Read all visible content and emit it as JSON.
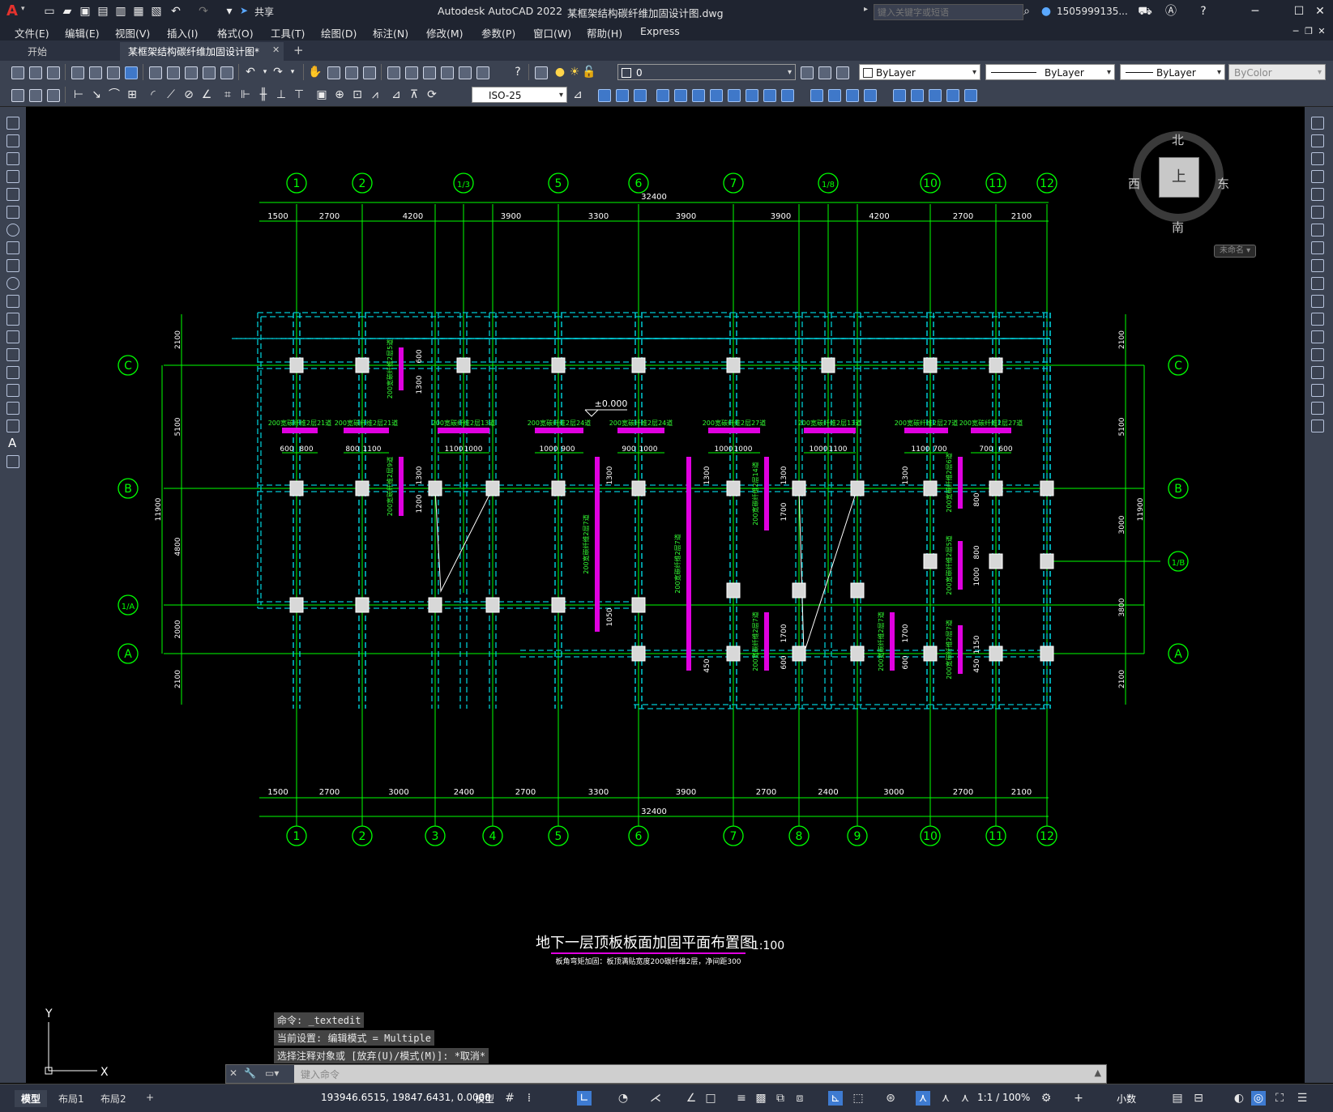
{
  "app": {
    "title": "Autodesk AutoCAD 2022",
    "filename": "某框架结构碳纤维加固设计图.dwg",
    "share_label": "共享",
    "search_placeholder": "键入关键字或短语",
    "user": "1505999135...",
    "logo_letter": "A"
  },
  "menu": [
    "文件(E)",
    "编辑(E)",
    "视图(V)",
    "插入(I)",
    "格式(O)",
    "工具(T)",
    "绘图(D)",
    "标注(N)",
    "修改(M)",
    "参数(P)",
    "窗口(W)",
    "帮助(H)",
    "Express"
  ],
  "tabs": {
    "start": "开始",
    "active": "某框架结构碳纤维加固设计图*",
    "add": "+"
  },
  "toolbar": {
    "layer_value": "0",
    "color": "ByLayer",
    "linetype": "ByLayer",
    "lineweight": "ByLayer",
    "plotstyle": "ByColor",
    "dimstyle": "ISO-25"
  },
  "viewcube": {
    "north": "北",
    "south": "南",
    "east": "东",
    "west": "西",
    "top": "上",
    "ucs": "未命名"
  },
  "drawing": {
    "title": "地下一层顶板板面加固平面布置图",
    "scale": "1:100",
    "note": "板角弯矩加固：板顶满贴宽度200碳纤维2层，净间距300",
    "elevation": "±0.000",
    "top_axes": [
      "1",
      "2",
      "1/3",
      "5",
      "6",
      "7",
      "1/8",
      "10",
      "11",
      "12"
    ],
    "bottom_axes": [
      "1",
      "2",
      "3",
      "4",
      "5",
      "6",
      "7",
      "8",
      "9",
      "10",
      "11",
      "12"
    ],
    "left_axes": [
      "C",
      "B",
      "1/A",
      "A"
    ],
    "right_axes": [
      "C",
      "B",
      "1/B",
      "A"
    ],
    "top_total": "32400",
    "top_dims": [
      "1500",
      "2700",
      "4200",
      "3900",
      "3300",
      "3900",
      "3900",
      "4200",
      "2700",
      "2100"
    ],
    "bottom_total": "32400",
    "bottom_dims": [
      "1500",
      "2700",
      "3000",
      "2400",
      "2700",
      "3300",
      "3900",
      "2700",
      "2400",
      "3000",
      "2700",
      "2100"
    ],
    "left_dims": [
      "2100",
      "5100",
      "4800",
      "2000",
      "2100"
    ],
    "left_total": "11900",
    "right_dims": [
      "2100",
      "5100",
      "3000",
      "3800",
      "2100"
    ],
    "right_total": "11900",
    "strip_labels": [
      "200宽碳纤维2层21道",
      "200宽碳纤维2层21道",
      "200宽碳纤维2层13道",
      "200宽碳纤维2层24道",
      "200宽碳纤维2层24道",
      "200宽碳纤维2层27道",
      "200宽碳纤维2层13道",
      "200宽碳纤维2层27道",
      "200宽碳纤维2层27道"
    ],
    "strip_dims": [
      [
        "600",
        "800"
      ],
      [
        "800",
        "1100"
      ],
      [
        "1100",
        "1000"
      ],
      [
        "1000",
        "900"
      ],
      [
        "900",
        "1000"
      ],
      [
        "1000",
        "1000"
      ],
      [
        "1000",
        "1100"
      ],
      [
        "1100",
        "700"
      ],
      [
        "700",
        "600"
      ]
    ],
    "vertical_strip_labels": [
      "200宽碳纤维2层5道",
      "200宽碳纤维2层9道",
      "200宽碳纤维2层7道",
      "200宽碳纤维2层7道",
      "200宽碳纤维2层14道",
      "200宽碳纤维2层6道",
      "200宽碳纤维2层5道",
      "200宽碳纤维2层7道",
      "200宽碳纤维2层7道",
      "200宽碳纤维2层7道"
    ],
    "vertical_dims": [
      "600",
      "1300",
      "1300",
      "1200",
      "1300",
      "1300",
      "1300",
      "1700",
      "1300",
      "800",
      "800",
      "1000",
      "1050",
      "1700",
      "600",
      "450",
      "1700",
      "600",
      "1150",
      "450"
    ]
  },
  "command": {
    "history": [
      "命令: _textedit",
      "当前设置: 编辑模式 = Multiple",
      "选择注释对象或 [放弃(U)/模式(M)]: *取消*"
    ],
    "placeholder": "键入命令"
  },
  "status": {
    "layouts": [
      "模型",
      "布局1",
      "布局2"
    ],
    "coords": "193946.6515, 19847.6431, 0.0000",
    "space": "模型",
    "scale": "1:1 / 100%",
    "units": "小数"
  },
  "colors": {
    "grid": "#00ff00",
    "beam": "#00c8d2",
    "fiber": "#e000e0",
    "bg": "#000000",
    "ui": "#3b4251"
  }
}
